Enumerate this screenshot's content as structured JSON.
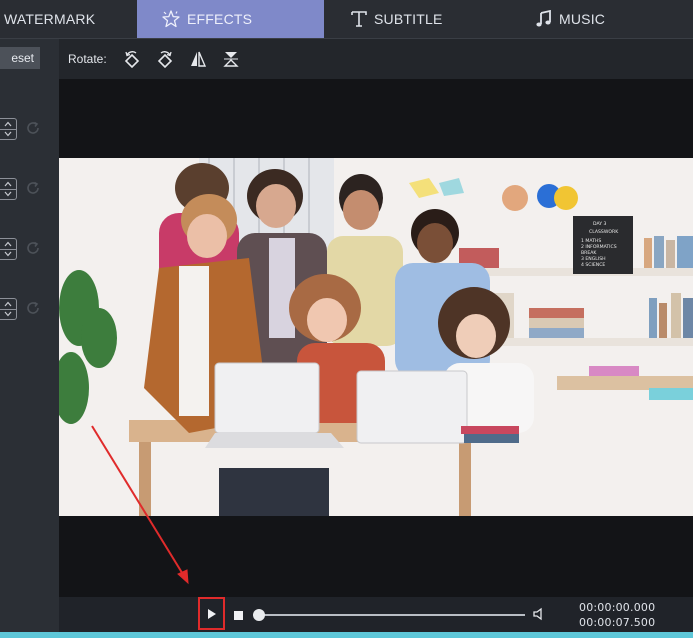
{
  "tabs": {
    "watermark": "WATERMARK",
    "effects": "EFFECTS",
    "subtitle": "SUBTITLE",
    "music": "MUSIC"
  },
  "left_panel": {
    "reset_label": "eset",
    "control_count": 4
  },
  "toolbar": {
    "rotate_label": "Rotate:",
    "rotate_buttons": [
      "rotate-left-icon",
      "rotate-right-icon",
      "flip-horizontal-icon",
      "flip-vertical-icon"
    ]
  },
  "preview": {
    "blackboard_lines": [
      "DAY 3",
      "CLASSWORK",
      "1 MATHS",
      "2 INFORMATICS",
      "BREAK",
      "3 ENGLISH",
      "4 SCIENCE"
    ]
  },
  "playback": {
    "current_time": "00:00:00.000",
    "total_time": "00:00:07.500",
    "progress": 0
  },
  "colors": {
    "active_tab": "#7f89c9",
    "highlight": "#e02b2b",
    "accent_strip": "#5ec7d8"
  }
}
